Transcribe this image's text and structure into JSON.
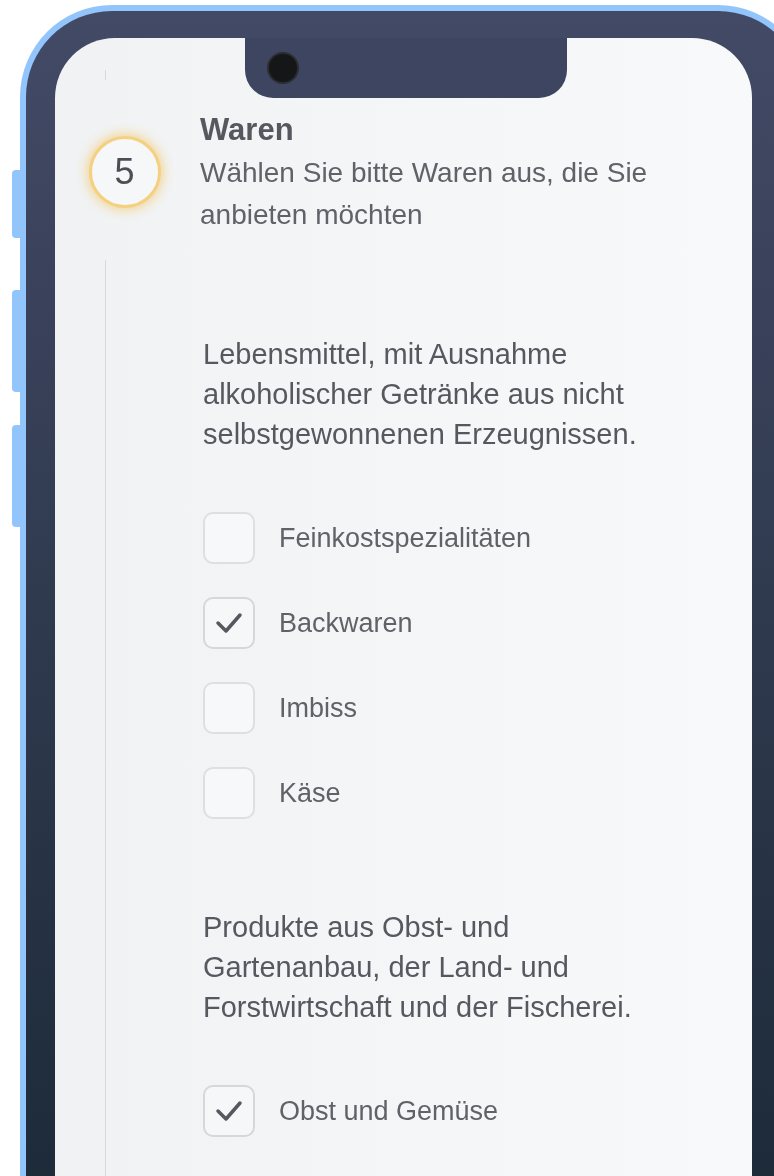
{
  "step": {
    "number": "5",
    "title": "Waren",
    "subtitle": "Wählen Sie bitte Waren aus, die Sie anbieten möchten"
  },
  "groups": [
    {
      "heading": [
        "Lebensmittel, mit Ausnahme",
        "alkoholischer Getränke aus nicht",
        "selbstgewonnenen Erzeugnissen."
      ],
      "options": [
        {
          "label": "Feinkostspezialitäten",
          "checked": false
        },
        {
          "label": "Backwaren",
          "checked": true
        },
        {
          "label": "Imbiss",
          "checked": false
        },
        {
          "label": "Käse",
          "checked": false
        }
      ]
    },
    {
      "heading": [
        "Produkte aus Obst- und",
        "Gartenanbau, der Land- und",
        "Forstwirtschaft und der Fischerei."
      ],
      "options": [
        {
          "label": "Obst und Gemüse",
          "checked": true
        }
      ]
    }
  ]
}
